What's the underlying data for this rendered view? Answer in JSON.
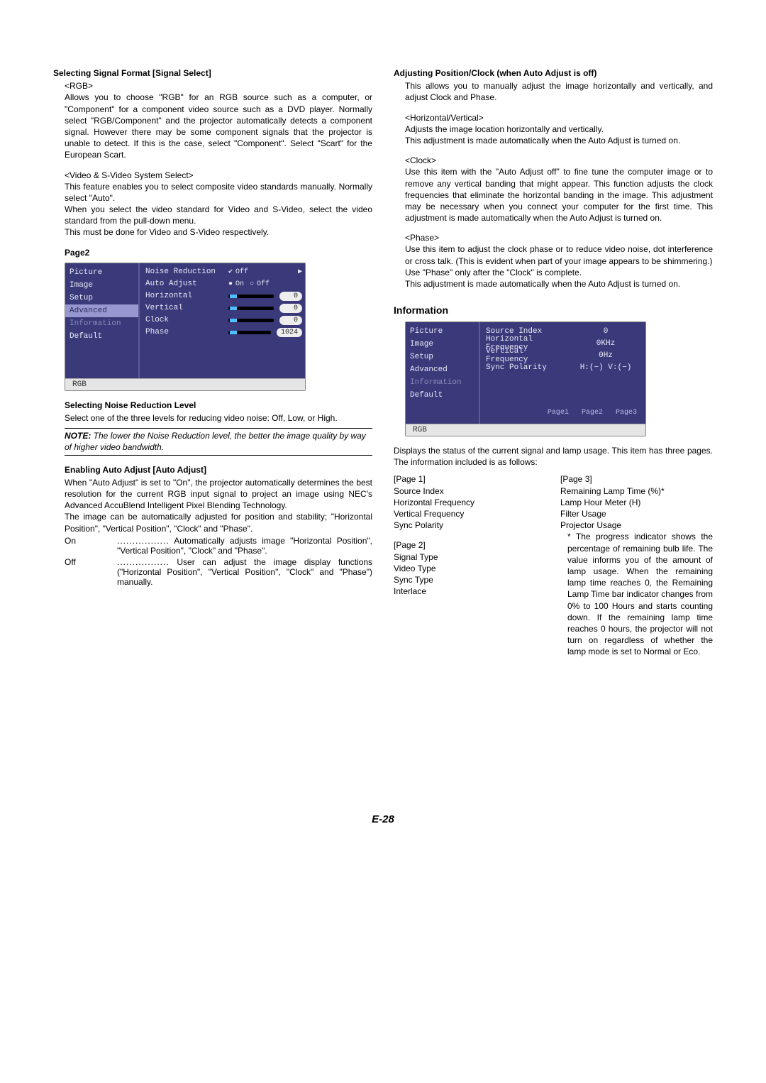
{
  "left": {
    "h_signal": "Selecting Signal Format [Signal Select]",
    "rgb_tag": "<RGB>",
    "rgb_p": "Allows you to choose \"RGB\" for an RGB source such as a computer, or \"Component\" for a component video source such as a DVD player. Normally select \"RGB/Component\" and the projector automatically detects a component signal. However there may be some component signals that the projector is unable to detect. If this is the case, select \"Component\". Select \"Scart\" for the European Scart.",
    "vid_tag": "<Video & S-Video System Select>",
    "vid_p1": "This feature enables you to select composite video standards manually. Normally select \"Auto\".",
    "vid_p2": "When you select the video standard for Video and S-Video, select the video standard from the pull-down menu.",
    "vid_p3": "This must be done for Video and S-Video respectively.",
    "page2": "Page2",
    "h_noise": "Selecting Noise Reduction Level",
    "noise_p": "Select one of the three levels for reducing video noise: Off, Low, or High.",
    "note_label": "NOTE:",
    "note_text": " The lower the Noise Reduction level, the better the image quality by way of higher video bandwidth.",
    "h_auto": "Enabling Auto Adjust [Auto Adjust]",
    "auto_p1": "When \"Auto Adjust\" is set to \"On\", the projector automatically determines the best resolution for the current RGB input signal to project an image using NEC's Advanced AccuBlend Intelligent Pixel Blending Technology.",
    "auto_p2": "The image can be automatically adjusted for position and stability; \"Horizontal Position\", \"Vertical Position\", \"Clock\" and \"Phase\".",
    "on_label": "On",
    "on_def": "Automatically adjusts image \"Horizontal Position\", \"Vertical Position\", \"Clock\" and \"Phase\".",
    "off_label": "Off",
    "off_def": "User can adjust the image display functions (\"Horizontal Position\", \"Vertical Position\", \"Clock\" and \"Phase\") manually."
  },
  "right": {
    "h_pos": "Adjusting Position/Clock (when Auto Adjust is off)",
    "pos_p": "This allows you to manually adjust the image horizontally and vertically, and adjust Clock and Phase.",
    "hv_tag": "<Horizontal/Vertical>",
    "hv_p1": "Adjusts the image location horizontally and vertically.",
    "hv_p2": "This adjustment is made automatically when the Auto Adjust is turned on.",
    "clock_tag": "<Clock>",
    "clock_p": "Use this item with the \"Auto Adjust off\" to fine tune the computer image or to remove any vertical banding that might appear. This function adjusts the clock frequencies that eliminate the horizontal banding in the image. This adjustment may be necessary when you connect your computer for the first time. This adjustment is made automatically when the Auto Adjust is turned on.",
    "phase_tag": "<Phase>",
    "phase_p1": "Use this item to adjust the clock phase or to reduce video noise, dot interference or cross talk. (This is evident when part of your image appears to be shimmering.)",
    "phase_p2": "Use \"Phase\" only after the \"Clock\" is complete.",
    "phase_p3": "This adjustment is made automatically when the Auto Adjust is turned on.",
    "h_info": "Information",
    "info_p": "Displays the status of the current signal and lamp usage. This item has three pages. The information included is as follows:",
    "pg1_h": "[Page 1]",
    "pg1_a": "Source Index",
    "pg1_b": "Horizontal Frequency",
    "pg1_c": "Vertical Frequency",
    "pg1_d": "Sync Polarity",
    "pg2_h": "[Page 2]",
    "pg2_a": "Signal Type",
    "pg2_b": "Video Type",
    "pg2_c": "Sync Type",
    "pg2_d": "Interlace",
    "pg3_h": "[Page 3]",
    "pg3_a": "Remaining Lamp Time (%)*",
    "pg3_b": "Lamp Hour Meter (H)",
    "pg3_c": "Filter Usage",
    "pg3_d": "Projector Usage",
    "star": "* The progress indicator shows the percentage of remaining bulb life. The value informs you of the amount of lamp usage. When the remaining lamp time reaches 0, the Remaining Lamp Time bar indicator changes from 0% to 100 Hours and starts counting down. If the remaining lamp time reaches 0 hours, the projector will not turn on regardless of whether the lamp mode is set to Normal or Eco."
  },
  "osd1": {
    "sidebar": [
      "Picture",
      "Image",
      "Setup",
      "Advanced",
      "Information",
      "Default"
    ],
    "rows": {
      "nr": "Noise Reduction",
      "nr_v": "Off",
      "aa": "Auto Adjust",
      "aa_on": "On",
      "aa_off": "Off",
      "h": "Horizontal",
      "h_v": "0",
      "v": "Vertical",
      "v_v": "0",
      "c": "Clock",
      "c_v": "0",
      "p": "Phase",
      "p_v": "1024"
    },
    "footer": "RGB"
  },
  "osd2": {
    "sidebar": [
      "Picture",
      "Image",
      "Setup",
      "Advanced",
      "Information",
      "Default"
    ],
    "rows": {
      "si": "Source Index",
      "si_v": "0",
      "hf": "Horizontal Frequency",
      "hf_v": "0KHz",
      "vf": "Vertical Frequency",
      "vf_v": "0Hz",
      "sp": "Sync Polarity",
      "sp_v": "H:(−)  V:(−)"
    },
    "pages": {
      "p1": "Page1",
      "p2": "Page2",
      "p3": "Page3"
    },
    "footer": "RGB"
  },
  "dots": ".................",
  "page_num": "E-28"
}
